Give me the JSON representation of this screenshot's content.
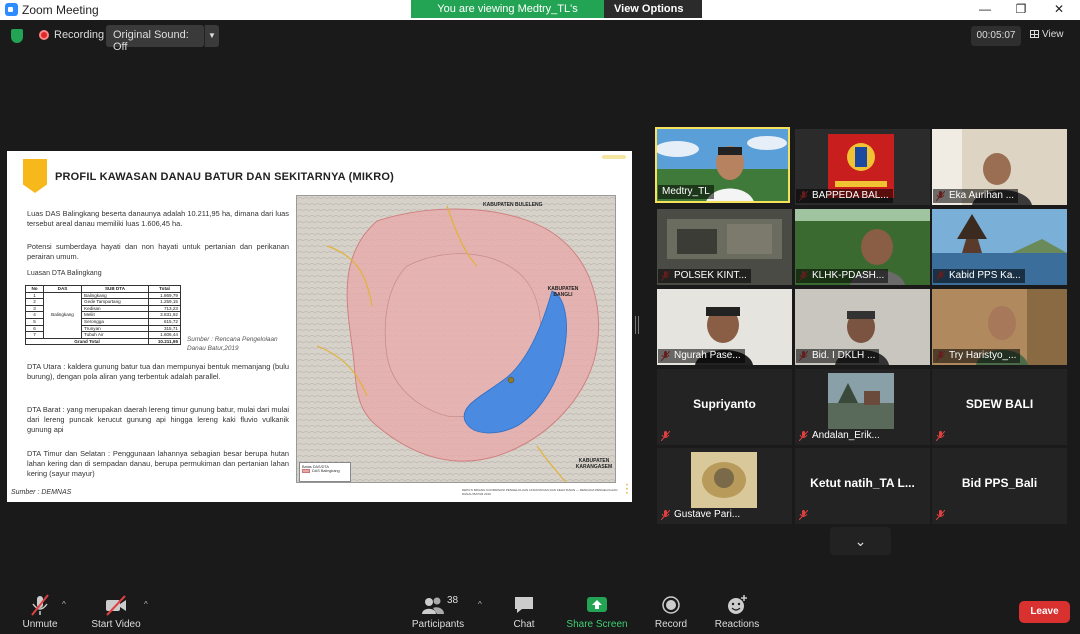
{
  "window": {
    "title": "Zoom Meeting",
    "minimize": "—",
    "restore": "❐",
    "close": "✕"
  },
  "banner": {
    "viewing_text": "You are viewing Medtry_TL's screen",
    "view_options": "View Options ⌄"
  },
  "topbar": {
    "recording": "Recording",
    "original_sound": "Original Sound: Off",
    "timer": "00:05:07",
    "view": "View"
  },
  "slide": {
    "title": "PROFIL KAWASAN DANAU BATUR DAN SEKITARNYA (MIKRO)",
    "para1": "Luas DAS Balingkang beserta danaunya adalah 10.211,95 ha, dimana dari luas tersebut areal danau memiliki luas 1.606,45 ha.",
    "para2": "Potensi sumberdaya hayati dan non hayati untuk pertanian dan perikanan perairan umum.",
    "table_title": "Luasan DTA Balingkang",
    "table_headers": [
      "No",
      "DAS",
      "SUB DTA",
      "Total"
    ],
    "das_name": "Balingkang",
    "rows": [
      {
        "no": "1",
        "sub": "Balingkang",
        "total": "1.869,79"
      },
      {
        "no": "2",
        "sub": "Gede Tampurtang",
        "total": "1.259,15"
      },
      {
        "no": "3",
        "sub": "Kedisan",
        "total": "713,23"
      },
      {
        "no": "4",
        "sub": "Meliit",
        "total": "3.831,92"
      },
      {
        "no": "5",
        "sub": "Serongga",
        "total": "615,72"
      },
      {
        "no": "6",
        "sub": "Trunyan",
        "total": "315,71"
      },
      {
        "no": "7",
        "sub": "Tubuh Air",
        "total": "1.606,44"
      }
    ],
    "grand_total_label": "Grand Total",
    "grand_total": "10.211,95",
    "sumber_right": "Sumber : Rencana Pengelolaan Danau Batur,2019",
    "para3": "DTA Utara : kaldera gunung batur tua dan mempunyai bentuk memanjang (bulu burung), dengan pola aliran yang terbentuk adalah parallel.",
    "para4": "DTA Barat : yang merupakan daerah lereng timur gunung batur, mulai dari mulai dari lereng puncak kerucut gunung api hingga lereng kaki fluvio vulkanik gunung api",
    "para5": "DTA Timur dan Selatan : Penggunaan lahannya sebagian besar berupa hutan lahan kering dan di sempadan danau, berupa permukiman dan pertanian lahan kering (sayur mayur)",
    "sumber_left": "Sumber : DEMNAS",
    "map": {
      "label_buleleng": "KABUPATEN BULELENG",
      "label_bangli": "KABUPATEN BANGLI",
      "label_karangasem": "KABUPATEN KARANGASEM",
      "legend_title": "Batas DAS/DTA",
      "legend_item": "DAS Balingkang"
    },
    "footnote": "DEPUTI BIDANG KOORDINASI PENGELOLAAN LINGKUNGAN DAN KEHUTANAN — RENCANA PENGELOLAAN DANAU BATUR 2019"
  },
  "participants": [
    {
      "name": "Medtry_TL",
      "muted": false,
      "active": true
    },
    {
      "name": "BAPPEDA BAL...",
      "muted": true
    },
    {
      "name": "Eka Aurihan ...",
      "muted": true
    },
    {
      "name": "POLSEK KINT...",
      "muted": true
    },
    {
      "name": "KLHK-PDASH...",
      "muted": true
    },
    {
      "name": "Kabid PPS Ka...",
      "muted": true
    },
    {
      "name": "Ngurah Pase...",
      "muted": true
    },
    {
      "name": "Bid. I DKLH ...",
      "muted": true
    },
    {
      "name": "Try Haristyo_...",
      "muted": true
    },
    {
      "name": "Supriyanto",
      "muted": true,
      "no_video": true
    },
    {
      "name": "Andalan_Erik...",
      "muted": true
    },
    {
      "name": "SDEW BALI",
      "muted": true,
      "no_video": true
    },
    {
      "name": "Gustave Pari...",
      "muted": true
    },
    {
      "name": "Ketut natih_TA L...",
      "muted": true,
      "no_video": true
    },
    {
      "name": "Bid PPS_Bali",
      "muted": true,
      "no_video": true
    }
  ],
  "bottombar": {
    "unmute": "Unmute",
    "start_video": "Start Video",
    "participants": "Participants",
    "participants_count": "38",
    "chat": "Chat",
    "share_screen": "Share Screen",
    "record": "Record",
    "reactions": "Reactions",
    "leave": "Leave"
  },
  "colors": {
    "accent_green": "#23a455",
    "leave_red": "#d93030",
    "lake_blue": "#4a8ae0",
    "das_pink": "#e8a8a8"
  }
}
